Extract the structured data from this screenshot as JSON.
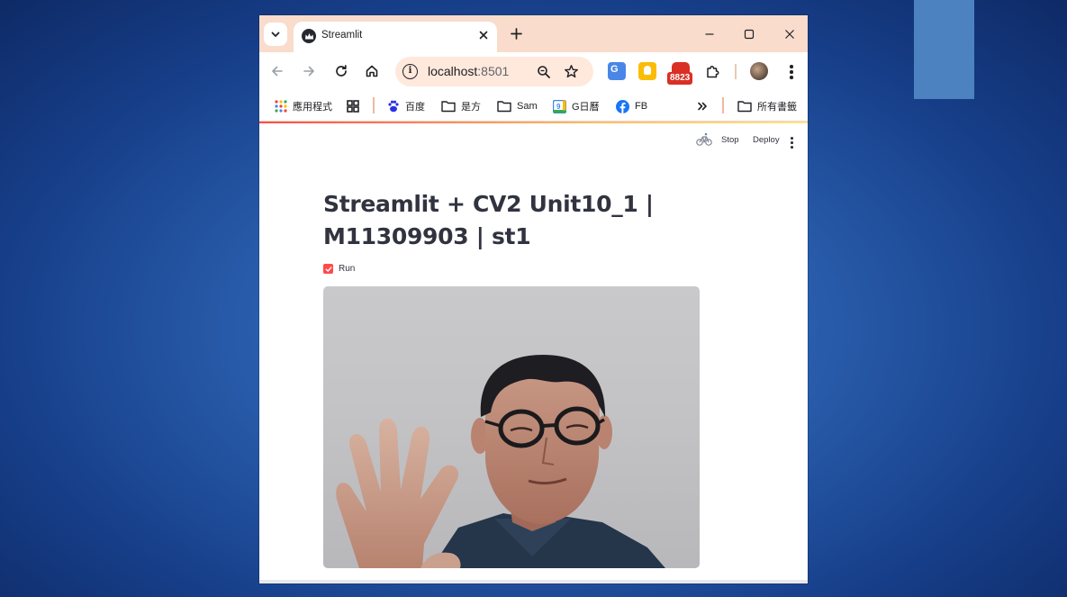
{
  "browser": {
    "tab": {
      "title": "Streamlit"
    },
    "address_bar": {
      "host": "localhost",
      "port": ":8501"
    },
    "extension_badge": "8823",
    "bookmarks": [
      {
        "label": "應用程式",
        "icon": "apps-grid-icon"
      },
      {
        "label": "",
        "icon": "grid-icon"
      },
      {
        "label": "百度",
        "icon": "baidu-paw-icon"
      },
      {
        "label": "是方",
        "icon": "folder-icon"
      },
      {
        "label": "Sam",
        "icon": "folder-icon"
      },
      {
        "label": "G日曆",
        "icon": "google-calendar-icon"
      },
      {
        "label": "FB",
        "icon": "facebook-icon"
      },
      {
        "label": "所有書籤",
        "icon": "folder-icon"
      }
    ]
  },
  "streamlit": {
    "header": {
      "stop_label": "Stop",
      "deploy_label": "Deploy"
    },
    "title": "Streamlit + CV2 Unit10_1 | M11309903 | st1",
    "checkbox": {
      "label": "Run",
      "checked": true
    },
    "video_frame": {
      "description_icon": "webcam-frame"
    }
  },
  "colors": {
    "accent": "#ff4b4b",
    "tabstrip": "#f9dccc",
    "background_blue": "#2a5fae"
  }
}
